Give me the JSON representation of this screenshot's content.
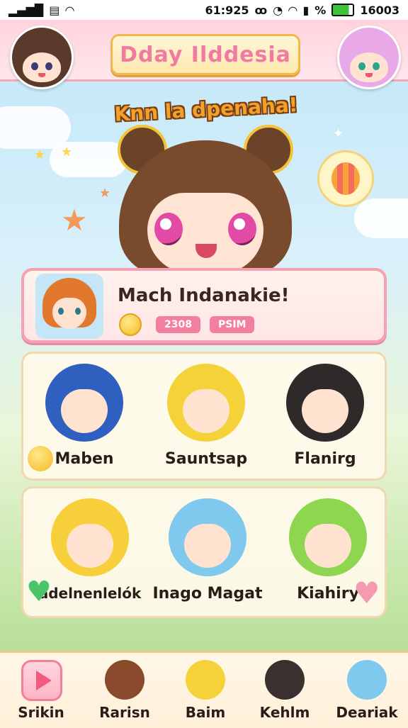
{
  "status_bar": {
    "time": "61:925",
    "battery": "16003",
    "icons": [
      "signal-icon",
      "sim-icon",
      "wifi-icon",
      "alarm-icon",
      "clock-icon",
      "wifi-icon",
      "signal-icon",
      "percent-icon",
      "battery-icon"
    ]
  },
  "header": {
    "title": "Dday Ilddesia",
    "left_avatar_icon": "girl-avatar-icon",
    "right_avatar_icon": "pink-hair-avatar-icon"
  },
  "subtitle": "Knn la dpenaha!",
  "banner": {
    "text": "Mach Indanakie!",
    "tag1": "2308",
    "tag2": "PSIM",
    "coin_icon": "coin-icon"
  },
  "characters_row1": [
    {
      "name": "Maben",
      "hair": "#2f5fbf"
    },
    {
      "name": "Sauntsap",
      "hair": "#f6d23a"
    },
    {
      "name": "Flanirg",
      "hair": "#2e2a2a"
    }
  ],
  "characters_row2": [
    {
      "name": "ādelnenlelók",
      "hair": "#f7cf3a"
    },
    {
      "name": "Inago Magat",
      "hair": "#7fc8ee"
    },
    {
      "name": "Kiahiry",
      "hair": "#8fd650"
    }
  ],
  "bottom_tabs": [
    {
      "label": "Srikin",
      "icon": "play-icon",
      "color": "#ffb5c6"
    },
    {
      "label": "Rarisn",
      "icon": "brown-hair-avatar-icon",
      "color": "#8a4a2c"
    },
    {
      "label": "Baim",
      "icon": "blonde-avatar-icon",
      "color": "#f6d23a"
    },
    {
      "label": "Kehlm",
      "icon": "black-hair-avatar-icon",
      "color": "#3a3030"
    },
    {
      "label": "Deariak",
      "icon": "blue-hair-avatar-icon",
      "color": "#7fc8ee"
    }
  ],
  "colors": {
    "accent_pink": "#f27ea0",
    "title_gold": "#f1b84e"
  }
}
